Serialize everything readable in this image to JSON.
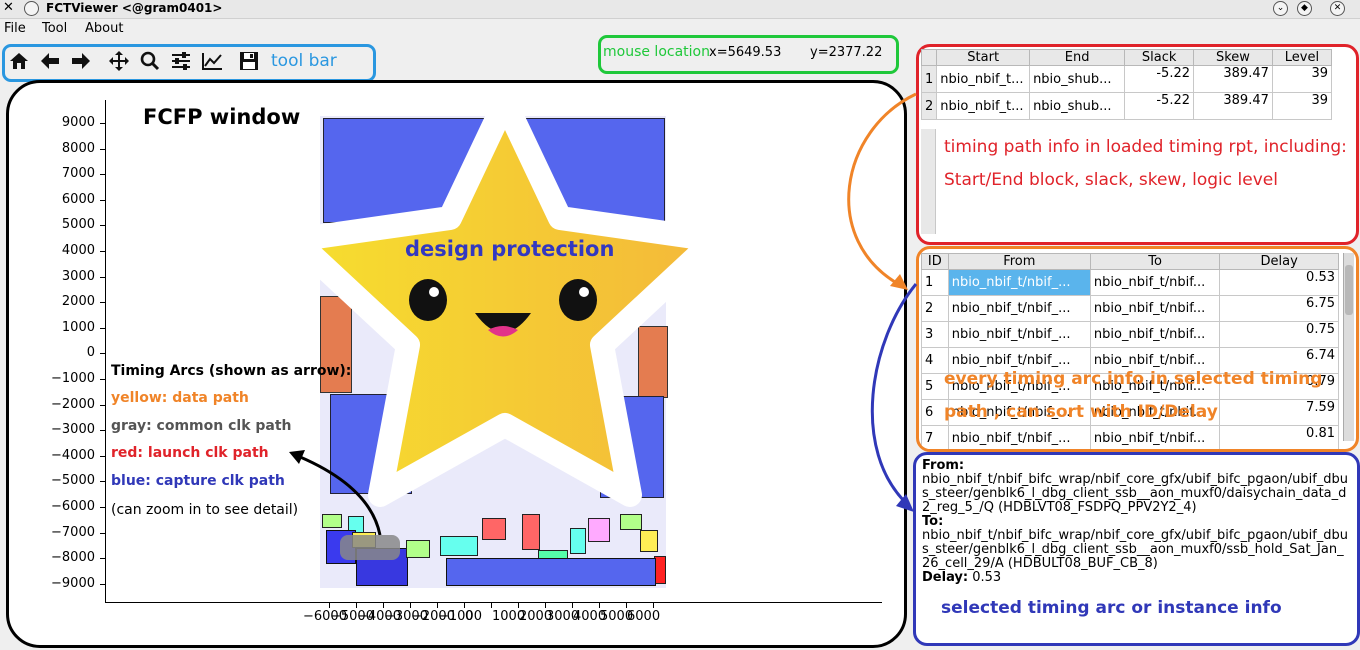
{
  "window": {
    "title": "FCTViewer <@gram0401>"
  },
  "menu": [
    "File",
    "Tool",
    "About"
  ],
  "toolbar": {
    "icons": [
      "home-icon",
      "back-arrow-icon",
      "forward-arrow-icon",
      "pan-icon",
      "zoom-icon",
      "configure-icon",
      "edit-axes-icon",
      "save-icon"
    ],
    "annotation": "tool bar"
  },
  "mouse": {
    "annotation": "mouse location",
    "x": "x=5649.53",
    "y": "y=2377.22"
  },
  "fcfp": {
    "annotation": "FCFP window",
    "y_ticks": [
      "9000",
      "8000",
      "7000",
      "6000",
      "5000",
      "4000",
      "3000",
      "2000",
      "1000",
      "0",
      "−1000",
      "−2000",
      "−3000",
      "−4000",
      "−5000",
      "−6000",
      "−7000",
      "−8000",
      "−9000"
    ],
    "x_ticks": [
      "−6000",
      "−5000",
      "−4000",
      "−3000",
      "−2000",
      "−1000",
      "0",
      "1000",
      "2000",
      "3000",
      "4000",
      "5000",
      "6000"
    ],
    "legend": {
      "title": "Timing Arcs (shown as arrow):",
      "items": [
        {
          "text": "yellow: data path",
          "color": "#f08428"
        },
        {
          "text": "gray: common clk path",
          "color": "#555555"
        },
        {
          "text": "red: launch clk path",
          "color": "#e0232a"
        },
        {
          "text": "blue: capture clk path",
          "color": "#3038b8"
        }
      ],
      "note": "(can zoom in to see detail)"
    },
    "star_label": "design protection"
  },
  "path_table": {
    "headers": [
      "Start",
      "End",
      "Slack",
      "Skew",
      "Level"
    ],
    "rows": [
      {
        "num": "1",
        "start": "nbio_nbif_t...",
        "end": "nbio_shub...",
        "slack": "-5.22",
        "skew": "389.47",
        "level": "39"
      },
      {
        "num": "2",
        "start": "nbio_nbif_t...",
        "end": "nbio_shub...",
        "slack": "-5.22",
        "skew": "389.47",
        "level": "39"
      }
    ],
    "annotation_line1": "timing path info in loaded timing rpt, including:",
    "annotation_line2": "Start/End block, slack, skew, logic level"
  },
  "arc_table": {
    "headers": [
      "ID",
      "From",
      "To",
      "Delay"
    ],
    "rows": [
      {
        "id": "1",
        "from": "nbio_nbif_t/nbif_...",
        "to": "nbio_nbif_t/nbif...",
        "delay": "0.53"
      },
      {
        "id": "2",
        "from": "nbio_nbif_t/nbif_...",
        "to": "nbio_nbif_t/nbif...",
        "delay": "6.75"
      },
      {
        "id": "3",
        "from": "nbio_nbif_t/nbif_...",
        "to": "nbio_nbif_t/nbif...",
        "delay": "0.75"
      },
      {
        "id": "4",
        "from": "nbio_nbif_t/nbif_...",
        "to": "nbio_nbif_t/nbif...",
        "delay": "6.74"
      },
      {
        "id": "5",
        "from": "nbio_nbif_t/nbif_...",
        "to": "nbio_nbif_t/nbif...",
        "delay": "0.79"
      },
      {
        "id": "6",
        "from": "nbio_nbif_t/nbif_...",
        "to": "nbio_nbif_t/nbif...",
        "delay": "7.59"
      },
      {
        "id": "7",
        "from": "nbio_nbif_t/nbif_...",
        "to": "nbio_nbif_t/nbif...",
        "delay": "0.81"
      }
    ],
    "annotation_line1": "every timing arc info in selected timing",
    "annotation_line2": "path , can sort with ID/Delay"
  },
  "arc_info": {
    "from_label": "From:",
    "from_value": "nbio_nbif_t/nbif_bifc_wrap/nbif_core_gfx/ubif_bifc_pgaon/ubif_dbus_steer/genblk6_l_dbg_client_ssb__aon_muxf0/daisychain_data_d2_reg_5_/Q (HDBLVT08_FSDPQ_PPV2Y2_4)",
    "to_label": "To:",
    "to_value": "nbio_nbif_t/nbif_bifc_wrap/nbif_core_gfx/ubif_bifc_pgaon/ubif_dbus_steer/genblk6_l_dbg_client_ssb__aon_muxf0/ssb_hold_Sat_Jan_26_cell_29/A (HDBULT08_BUF_CB_8)",
    "delay_label": "Delay:",
    "delay_value": "0.53",
    "annotation": "selected timing arc or instance info"
  }
}
